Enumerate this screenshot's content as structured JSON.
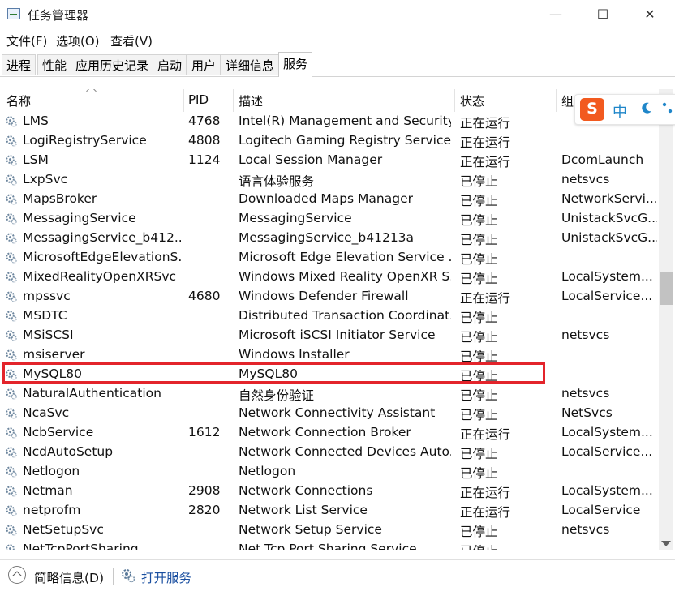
{
  "window": {
    "title": "任务管理器",
    "minimize": "—",
    "maximize": "☐",
    "close": "✕"
  },
  "menu": [
    "文件(F)",
    "选项(O)",
    "查看(V)"
  ],
  "tabs": [
    "进程",
    "性能",
    "应用历史记录",
    "启动",
    "用户",
    "详细信息",
    "服务"
  ],
  "active_tab": "服务",
  "columns": {
    "name": "名称",
    "pid": "PID",
    "desc": "描述",
    "status": "状态",
    "group": "组"
  },
  "services": [
    {
      "name": "LMS",
      "pid": "4768",
      "desc": "Intel(R) Management and Security...",
      "status": "正在运行",
      "group": ""
    },
    {
      "name": "LogiRegistryService",
      "pid": "4808",
      "desc": "Logitech Gaming Registry Service",
      "status": "正在运行",
      "group": ""
    },
    {
      "name": "LSM",
      "pid": "1124",
      "desc": "Local Session Manager",
      "status": "正在运行",
      "group": "DcomLaunch"
    },
    {
      "name": "LxpSvc",
      "pid": "",
      "desc": "语言体验服务",
      "status": "已停止",
      "group": "netsvcs"
    },
    {
      "name": "MapsBroker",
      "pid": "",
      "desc": "Downloaded Maps Manager",
      "status": "已停止",
      "group": "NetworkServi..."
    },
    {
      "name": "MessagingService",
      "pid": "",
      "desc": "MessagingService",
      "status": "已停止",
      "group": "UnistackSvcG..."
    },
    {
      "name": "MessagingService_b412...",
      "pid": "",
      "desc": "MessagingService_b41213a",
      "status": "已停止",
      "group": "UnistackSvcG..."
    },
    {
      "name": "MicrosoftEdgeElevationS...",
      "pid": "",
      "desc": "Microsoft Edge Elevation Service ...",
      "status": "已停止",
      "group": ""
    },
    {
      "name": "MixedRealityOpenXRSvc",
      "pid": "",
      "desc": "Windows Mixed Reality OpenXR S...",
      "status": "已停止",
      "group": "LocalSystem..."
    },
    {
      "name": "mpssvc",
      "pid": "4680",
      "desc": "Windows Defender Firewall",
      "status": "正在运行",
      "group": "LocalService..."
    },
    {
      "name": "MSDTC",
      "pid": "",
      "desc": "Distributed Transaction Coordinat...",
      "status": "已停止",
      "group": ""
    },
    {
      "name": "MSiSCSI",
      "pid": "",
      "desc": "Microsoft iSCSI Initiator Service",
      "status": "已停止",
      "group": "netsvcs"
    },
    {
      "name": "msiserver",
      "pid": "",
      "desc": "Windows Installer",
      "status": "已停止",
      "group": ""
    },
    {
      "name": "MySQL80",
      "pid": "",
      "desc": "MySQL80",
      "status": "已停止",
      "group": ""
    },
    {
      "name": "NaturalAuthentication",
      "pid": "",
      "desc": "自然身份验证",
      "status": "已停止",
      "group": "netsvcs"
    },
    {
      "name": "NcaSvc",
      "pid": "",
      "desc": "Network Connectivity Assistant",
      "status": "已停止",
      "group": "NetSvcs"
    },
    {
      "name": "NcbService",
      "pid": "1612",
      "desc": "Network Connection Broker",
      "status": "正在运行",
      "group": "LocalSystem..."
    },
    {
      "name": "NcdAutoSetup",
      "pid": "",
      "desc": "Network Connected Devices Auto...",
      "status": "已停止",
      "group": "LocalService..."
    },
    {
      "name": "Netlogon",
      "pid": "",
      "desc": "Netlogon",
      "status": "已停止",
      "group": ""
    },
    {
      "name": "Netman",
      "pid": "2908",
      "desc": "Network Connections",
      "status": "正在运行",
      "group": "LocalSystem..."
    },
    {
      "name": "netprofm",
      "pid": "2820",
      "desc": "Network List Service",
      "status": "正在运行",
      "group": "LocalService"
    },
    {
      "name": "NetSetupSvc",
      "pid": "",
      "desc": "Network Setup Service",
      "status": "已停止",
      "group": "netsvcs"
    },
    {
      "name": "NetTcpPortSharing",
      "pid": "",
      "desc": "Net.Tcp Port Sharing Service",
      "status": "已停止",
      "group": ""
    }
  ],
  "footer": {
    "fewer_details": "简略信息(D)",
    "open_services": "打开服务"
  },
  "ime": {
    "logo": "S",
    "mode": "中"
  }
}
